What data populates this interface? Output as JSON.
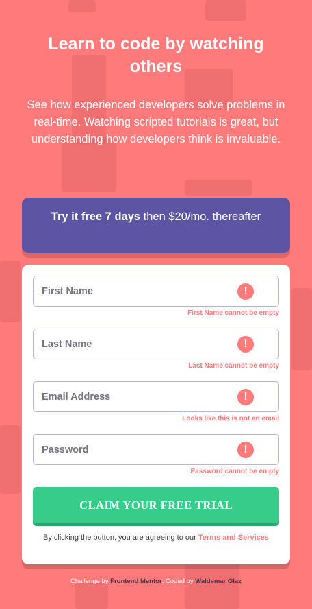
{
  "hero": {
    "title": "Learn to code by watching others",
    "text": "See how experienced developers solve problems in real-time. Watching scripted tutorials is great, but understanding how developers think is invaluable."
  },
  "promo": {
    "bold": "Try it free 7 days",
    "rest": " then $20/mo. thereafter"
  },
  "form": {
    "fields": [
      {
        "placeholder": "First Name",
        "value": "",
        "error": "First Name cannot be empty",
        "error_icon": "!"
      },
      {
        "placeholder": "Last Name",
        "value": "",
        "error": "Last Name cannot be empty",
        "error_icon": "!"
      },
      {
        "placeholder": "Email Address",
        "value": "",
        "error": "Looks like this is not an email",
        "error_icon": "!"
      },
      {
        "placeholder": "Password",
        "value": "",
        "error": "Password cannot be empty",
        "error_icon": "!"
      }
    ],
    "submit_label": "CLAIM YOUR FREE TRIAL",
    "terms_prefix": "By clicking the button, you are agreeing to our ",
    "terms_link": "Terms and Services"
  },
  "footer": {
    "challenge_by": "Challenge by ",
    "challenge_link": "Frontend Mentor",
    "separator": ". Coded by ",
    "coder_link": "Waldemar Glaz"
  },
  "colors": {
    "background": "#ff7a7a",
    "promo": "#5e54a4",
    "accent_green": "#38cc8b",
    "error": "#ff7a7a"
  }
}
